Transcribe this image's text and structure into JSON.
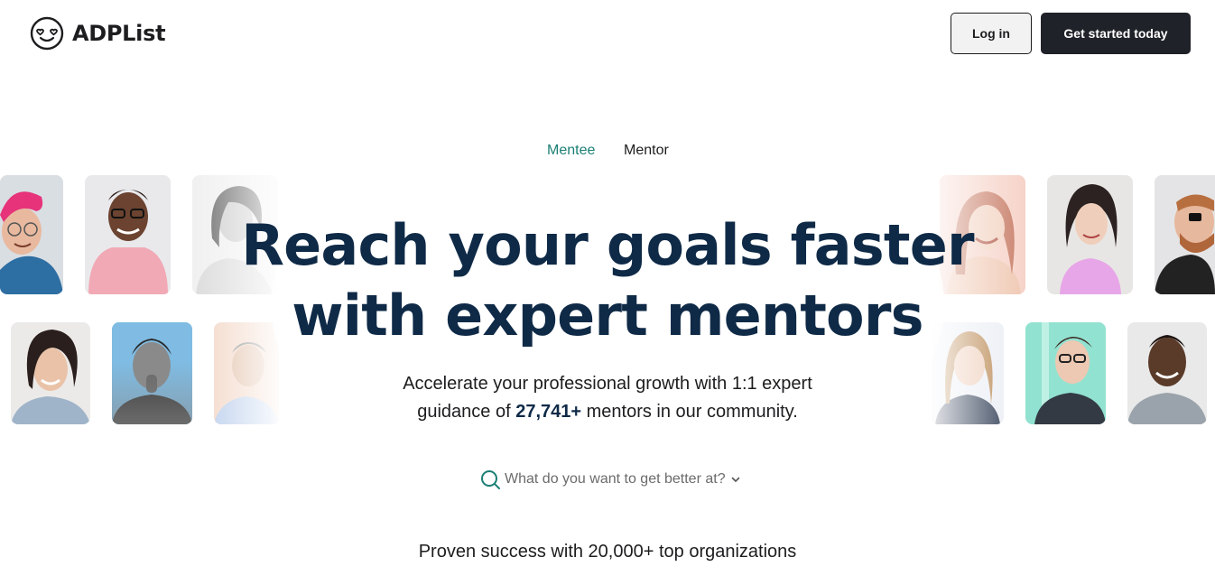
{
  "header": {
    "brand_name": "ADPList",
    "login_label": "Log in",
    "cta_label": "Get started today"
  },
  "tabs": [
    {
      "label": "Mentee",
      "active": true
    },
    {
      "label": "Mentor",
      "active": false
    }
  ],
  "hero": {
    "title_line1": "Reach your goals faster",
    "title_line2": "with expert mentors",
    "subtitle_part1": "Accelerate your professional growth with 1:1 expert",
    "subtitle_part2": "guidance of ",
    "mentor_count": "27,741+",
    "subtitle_part3": " mentors in our community."
  },
  "search": {
    "placeholder": "What do you want to get better at?"
  },
  "proof": {
    "text": "Proven success with 20,000+ top organizations"
  },
  "colors": {
    "accent": "#1b7f75",
    "title": "#0f2a47",
    "cta_bg": "#1f2228"
  },
  "icons": {
    "brand": "smiley-heart-eyes-icon",
    "search": "search-icon",
    "chevron": "chevron-down-icon"
  }
}
